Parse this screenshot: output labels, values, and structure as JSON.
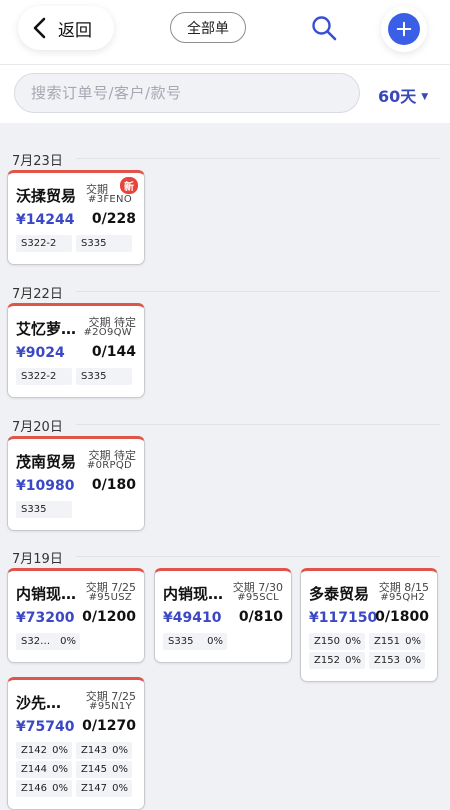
{
  "header": {
    "back_label": "返回",
    "filter_label": "全部单"
  },
  "search": {
    "placeholder": "搜索订单号/客户/款号",
    "days": "60天"
  },
  "colors": {
    "accent_blue": "#3a5fe6",
    "amount_color": "#3b48c4",
    "card_top_red": "#e05449",
    "new_badge": "#e8443b"
  },
  "groups": [
    {
      "date": "7月23日",
      "orders": [
        {
          "customer": "沃揉贸易",
          "delivery": "交期",
          "new_badge": "新",
          "code": "#3FENO",
          "amount": "¥14244",
          "progress": "0/228",
          "chips": [
            {
              "label": "S322-2",
              "pct": ""
            },
            {
              "label": "S335",
              "pct": ""
            }
          ]
        }
      ]
    },
    {
      "date": "7月22日",
      "orders": [
        {
          "customer": "艾忆萝…",
          "delivery": "交期 待定",
          "code": "#2O9QW",
          "amount": "¥9024",
          "progress": "0/144",
          "chips": [
            {
              "label": "S322-2",
              "pct": ""
            },
            {
              "label": "S335",
              "pct": ""
            }
          ]
        }
      ]
    },
    {
      "date": "7月20日",
      "orders": [
        {
          "customer": "茂南贸易",
          "delivery": "交期 待定",
          "code": "#0RPQD",
          "amount": "¥10980",
          "progress": "0/180",
          "chips": [
            {
              "label": "S335",
              "pct": ""
            }
          ]
        }
      ]
    },
    {
      "date": "7月19日",
      "orders": [
        {
          "customer": "内销现…",
          "delivery": "交期 7/25",
          "code": "#95USZ",
          "amount": "¥73200",
          "progress": "0/1200",
          "chips": [
            {
              "label": "S32…",
              "pct": "0%"
            }
          ]
        },
        {
          "customer": "内销现…",
          "delivery": "交期 7/30",
          "code": "#95SCL",
          "amount": "¥49410",
          "progress": "0/810",
          "chips": [
            {
              "label": "S335",
              "pct": "0%"
            }
          ]
        },
        {
          "customer": "多泰贸易",
          "delivery": "交期 8/15",
          "code": "#95QH2",
          "amount": "¥117150",
          "progress": "0/1800",
          "chips": [
            {
              "label": "Z150",
              "pct": "0%"
            },
            {
              "label": "Z151",
              "pct": "0%"
            },
            {
              "label": "Z152",
              "pct": "0%"
            },
            {
              "label": "Z153",
              "pct": "0%"
            }
          ]
        },
        {
          "customer": "沙先…",
          "delivery": "交期 7/25",
          "code": "#95N1Y",
          "amount": "¥75740",
          "progress": "0/1270",
          "chips": [
            {
              "label": "Z142",
              "pct": "0%"
            },
            {
              "label": "Z143",
              "pct": "0%"
            },
            {
              "label": "Z144",
              "pct": "0%"
            },
            {
              "label": "Z145",
              "pct": "0%"
            },
            {
              "label": "Z146",
              "pct": "0%"
            },
            {
              "label": "Z147",
              "pct": "0%"
            }
          ]
        }
      ]
    }
  ]
}
